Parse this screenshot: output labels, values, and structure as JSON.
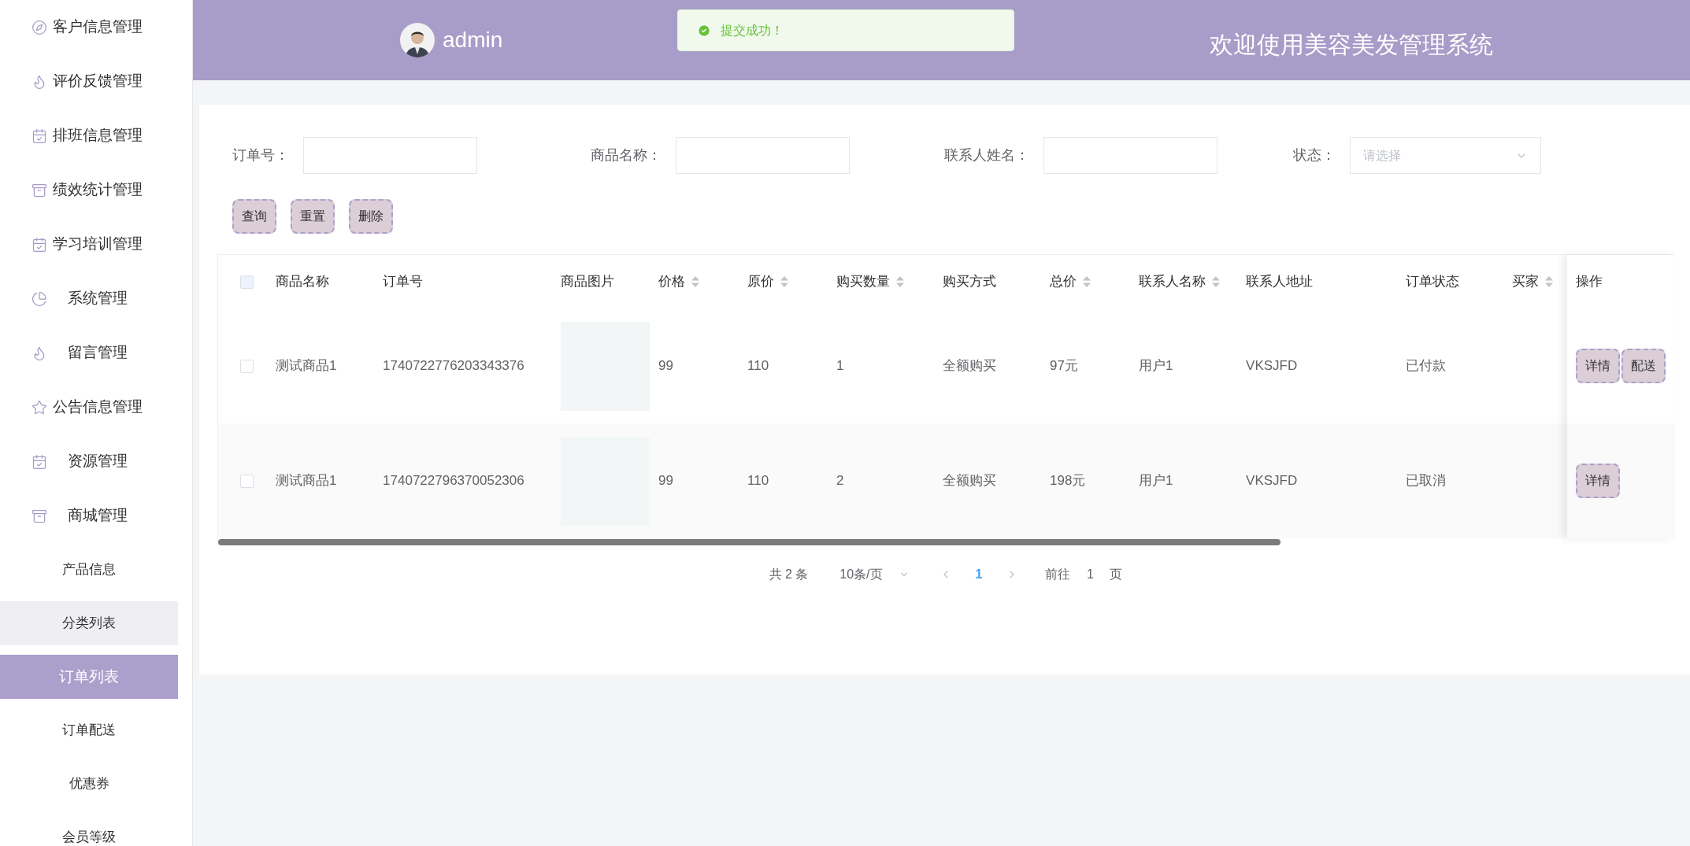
{
  "sidebar": {
    "menu": [
      {
        "label": "客户信息管理",
        "selected": false
      },
      {
        "label": "评价反馈管理",
        "selected": false
      },
      {
        "label": "排班信息管理",
        "selected": false
      },
      {
        "label": "绩效统计管理",
        "selected": false
      },
      {
        "label": "学习培训管理",
        "selected": false
      },
      {
        "label": "系统管理",
        "selected": false
      },
      {
        "label": "留言管理",
        "selected": false
      },
      {
        "label": "公告信息管理",
        "selected": false
      },
      {
        "label": "资源管理",
        "selected": false
      },
      {
        "label": "商城管理",
        "selected": false,
        "children": [
          {
            "label": "产品信息",
            "selected": false,
            "hovered": false
          },
          {
            "label": "分类列表",
            "selected": false,
            "hovered": true
          },
          {
            "label": "订单列表",
            "selected": true,
            "hovered": false
          },
          {
            "label": "订单配送",
            "selected": false,
            "hovered": false
          },
          {
            "label": "优惠券",
            "selected": false,
            "hovered": false
          },
          {
            "label": "会员等级",
            "selected": false,
            "hovered": false
          }
        ]
      }
    ]
  },
  "header": {
    "user": {
      "name": "admin"
    },
    "title": "欢迎使用美容美发管理系统"
  },
  "toast": {
    "kind": "success",
    "message": "提交成功！"
  },
  "filters": [
    {
      "label": "订单号：",
      "kind": "input"
    },
    {
      "label": "商品名称：",
      "kind": "input"
    },
    {
      "label": "联系人姓名：",
      "kind": "input"
    },
    {
      "label": "状态：",
      "kind": "select",
      "placeholder": "请选择"
    }
  ],
  "actions": [
    "查询",
    "重置",
    "删除"
  ],
  "table": {
    "header_checkbox": {
      "checked": false
    },
    "columns": [
      {
        "label": "商品名称",
        "sortable": false
      },
      {
        "label": "订单号",
        "sortable": false
      },
      {
        "label": "商品图片",
        "sortable": false
      },
      {
        "label": "价格",
        "sortable": true
      },
      {
        "label": "原价",
        "sortable": true
      },
      {
        "label": "购买数量",
        "sortable": true
      },
      {
        "label": "购买方式",
        "sortable": false
      },
      {
        "label": "总价",
        "sortable": true
      },
      {
        "label": "联系人名称",
        "sortable": true
      },
      {
        "label": "联系人地址",
        "sortable": false
      },
      {
        "label": "订单状态",
        "sortable": false
      },
      {
        "label": "买家",
        "sortable": true
      }
    ],
    "action_column": {
      "label": "操作"
    },
    "rows": [
      {
        "checked": false,
        "cells": [
          "测试商品1",
          "1740722776203343376",
          {
            "kind": "image"
          },
          "99",
          "110",
          "1",
          "全额购买",
          "97元",
          "用户1",
          "VKSJFD",
          "已付款"
        ],
        "actions": [
          "详情",
          "配送"
        ]
      },
      {
        "checked": false,
        "cells": [
          "测试商品1",
          "1740722796370052306",
          {
            "kind": "image"
          },
          "99",
          "110",
          "2",
          "全额购买",
          "198元",
          "用户1",
          "VKSJFD",
          "已取消"
        ],
        "actions": [
          "详情"
        ]
      }
    ]
  },
  "pagination": {
    "total": "共 2 条",
    "page_size": "10条/页",
    "pages": [
      {
        "label": "1",
        "selected": true
      }
    ],
    "goto_label": "前往",
    "goto_value": "1",
    "goto_suffix": "页"
  }
}
